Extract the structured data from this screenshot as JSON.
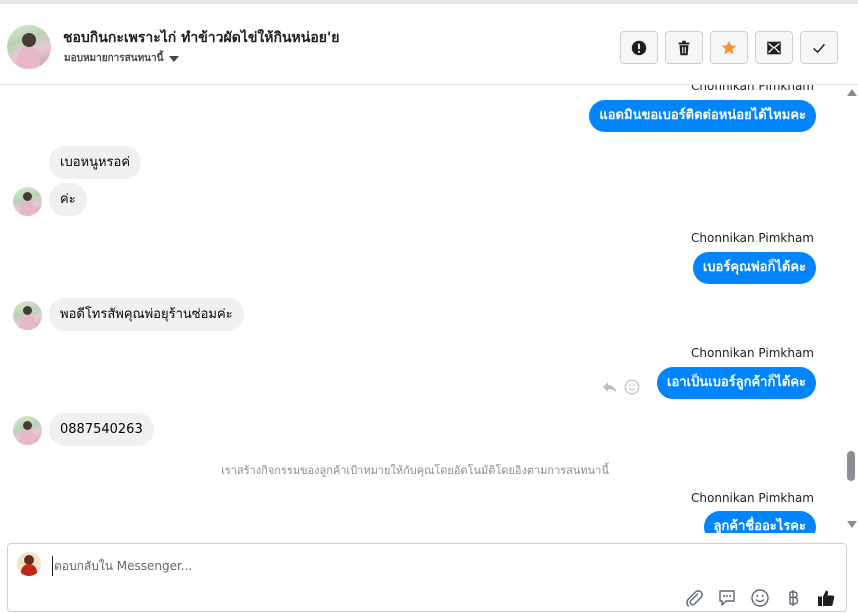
{
  "header": {
    "title": "ชอบกินกะเพราะไก่ ทำข้าวผัดไข่ให้กินหน่อย'ย",
    "assign_label": "มอบหมายการสนทนานี้",
    "toolbar": {
      "spam_icon": "exclamation-icon",
      "delete_icon": "trash-icon",
      "star_icon": "star-icon",
      "unread_icon": "envelope-icon",
      "done_icon": "check-icon"
    }
  },
  "messages": [
    {
      "direction": "out",
      "sender": "Chonnikan Pimkham",
      "text": "แอดมินขอเบอร์ติดต่อหน่อยได้ไหมคะ"
    },
    {
      "direction": "in",
      "text": "เบอหนูหรอค่"
    },
    {
      "direction": "in",
      "text": "ค่ะ"
    },
    {
      "direction": "out",
      "sender": "Chonnikan Pimkham",
      "text": "เบอร์คุณพ่อก็ได้คะ"
    },
    {
      "direction": "in",
      "text": "พอดีโทรสัพคุณพ่อยุร้านซ่อมค่ะ"
    },
    {
      "direction": "out",
      "sender": "Chonnikan Pimkham",
      "text": "เอาเป็นเบอร์ลูกค้าก็ได้คะ"
    },
    {
      "direction": "in",
      "text": "0887540263"
    },
    {
      "direction": "system",
      "text": "เราสร้างกิจกรรมของลูกค้าเป้าหมายให้กับคุณโดยอัตโนมัติโดยอิงตามการสนทนานี้"
    },
    {
      "direction": "out",
      "sender": "Chonnikan Pimkham",
      "text": "ลูกค้าชื่ออะไรคะ"
    }
  ],
  "composer": {
    "placeholder": "ตอบกลับใน Messenger..."
  },
  "colors": {
    "accent": "#0084ff",
    "star": "#f7923a",
    "incoming_bubble": "#f0f0f0"
  }
}
